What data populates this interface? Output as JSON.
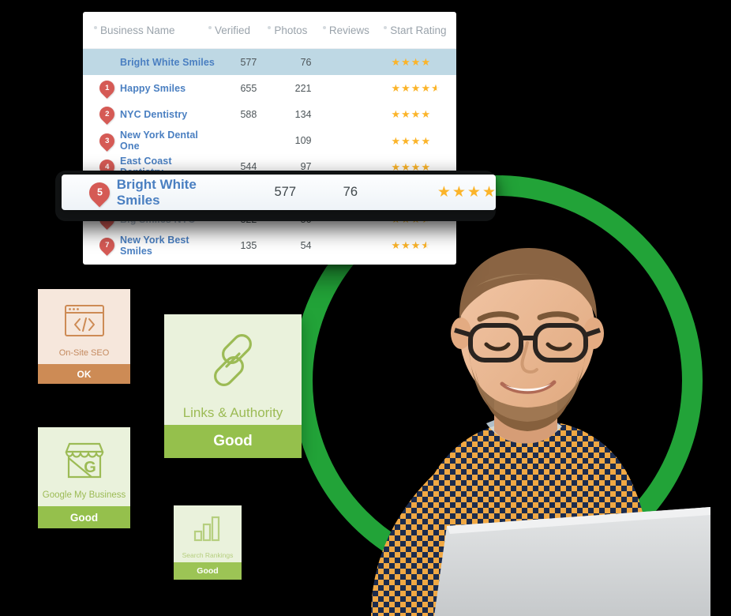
{
  "table": {
    "columns": [
      {
        "key": "name",
        "label": "Business Name"
      },
      {
        "key": "verified",
        "label": "Verified"
      },
      {
        "key": "photos",
        "label": "Photos"
      },
      {
        "key": "reviews",
        "label": "Reviews"
      },
      {
        "key": "rating",
        "label": "Start Rating"
      }
    ],
    "rows": [
      {
        "pin": "",
        "name": "Bright White Smiles",
        "verified": "577",
        "photos": "76",
        "reviews": "",
        "rating": 4,
        "highlight": true,
        "dim": false
      },
      {
        "pin": "1",
        "name": "Happy Smiles",
        "verified": "655",
        "photos": "221",
        "reviews": "",
        "rating": 4.5,
        "highlight": false,
        "dim": false
      },
      {
        "pin": "2",
        "name": "NYC Dentistry",
        "verified": "588",
        "photos": "134",
        "reviews": "",
        "rating": 4,
        "highlight": false,
        "dim": false
      },
      {
        "pin": "3",
        "name": "New York Dental One",
        "verified": "",
        "photos": "109",
        "reviews": "",
        "rating": 4,
        "highlight": false,
        "dim": false
      },
      {
        "pin": "4",
        "name": "East Coast Dentistry",
        "verified": "544",
        "photos": "97",
        "reviews": "",
        "rating": 4,
        "highlight": false,
        "dim": false
      },
      {
        "pin": "5",
        "name": "Bright White Smiles",
        "verified": "577",
        "photos": "76",
        "reviews": "",
        "rating": 4,
        "highlight": false,
        "dim": false
      },
      {
        "pin": "6",
        "name": "Big Smiles NYC",
        "verified": "322",
        "photos": "56",
        "reviews": "",
        "rating": 3.5,
        "highlight": false,
        "dim": true
      },
      {
        "pin": "7",
        "name": "New York Best Smiles",
        "verified": "135",
        "photos": "54",
        "reviews": "",
        "rating": 3.5,
        "highlight": false,
        "dim": false
      }
    ]
  },
  "magnifier": {
    "pin": "5",
    "name": "Bright White Smiles",
    "verified": "577",
    "photos": "76",
    "reviews": "",
    "rating": 4
  },
  "score_cards": [
    {
      "id": "on-site-seo",
      "label": "On-Site SEO",
      "status": "OK",
      "icon": "code-window-icon",
      "bg": "#f6e7dc",
      "accent": "#cd8b55",
      "text": "#c48a5f"
    },
    {
      "id": "links-authority",
      "label": "Links & Authority",
      "status": "Good",
      "icon": "chain-link-icon",
      "bg": "#eaf2dc",
      "accent": "#95c04c",
      "text": "#9cbb55"
    },
    {
      "id": "google-my-business",
      "label": "Google My Business",
      "status": "Good",
      "icon": "storefront-icon",
      "bg": "#eaf2dc",
      "accent": "#95c04c",
      "text": "#9cbb55"
    },
    {
      "id": "search-rankings",
      "label": "Search Rankings",
      "status": "Good",
      "icon": "bar-chart-icon",
      "bg": "#eaf2dc",
      "accent": "#9cc455",
      "text": "#b6cf7f"
    }
  ],
  "decor": {
    "ring_color": "#22a338",
    "pin_color": "#d55a55",
    "star_color": "#fbb429",
    "highlight_row_color": "#bed8e4",
    "link_color": "#4a7fc1"
  },
  "photo": {
    "alt": "man-with-glasses-and-beard-using-laptop"
  }
}
